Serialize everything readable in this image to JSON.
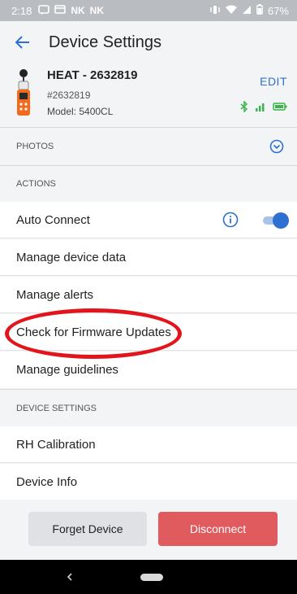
{
  "status_bar": {
    "time": "2:18",
    "notifications": [
      "NK",
      "NK"
    ],
    "battery": "67%"
  },
  "app_bar": {
    "title": "Device Settings"
  },
  "device": {
    "name": "HEAT - 2632819",
    "id": "#2632819",
    "model": "Model: 5400CL",
    "edit_label": "EDIT",
    "accent": "#2f6fd1",
    "status_green": "#39b54a"
  },
  "sections": {
    "photos": "PHOTOS",
    "actions": "ACTIONS",
    "device_settings": "DEVICE SETTINGS"
  },
  "actions": {
    "auto_connect": "Auto Connect",
    "auto_connect_enabled": true,
    "manage_device_data": "Manage device data",
    "manage_alerts": "Manage alerts",
    "check_firmware": "Check for Firmware Updates",
    "manage_guidelines": "Manage guidelines"
  },
  "device_settings": {
    "rh_calibration": "RH Calibration",
    "device_info": "Device Info"
  },
  "buttons": {
    "forget": "Forget Device",
    "disconnect": "Disconnect",
    "disconnect_color": "#e05b5e"
  },
  "icons": [
    "back-arrow-icon",
    "bluetooth-icon",
    "signal-icon",
    "battery-icon",
    "expand-icon",
    "info-icon"
  ]
}
